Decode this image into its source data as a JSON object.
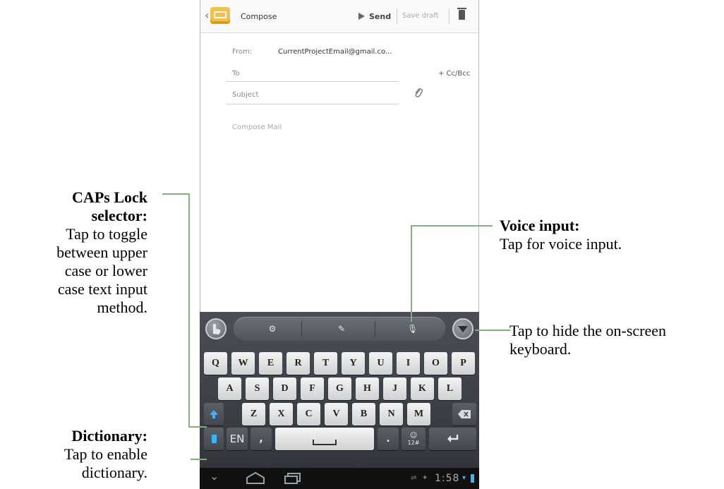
{
  "app": {
    "title": "Compose",
    "send_label": "Send",
    "save_draft_label": "Save draft",
    "from_label": "From:",
    "from_value": "CurrentProjectEmail@gmail.co...",
    "to_placeholder": "To",
    "ccbcc_label": "+ Cc/Bcc",
    "subject_placeholder": "Subject",
    "body_placeholder": "Compose Mail"
  },
  "keyboard": {
    "row1": [
      "Q",
      "W",
      "E",
      "R",
      "T",
      "Y",
      "U",
      "I",
      "O",
      "P"
    ],
    "row2": [
      "A",
      "S",
      "D",
      "F",
      "G",
      "H",
      "J",
      "K",
      "L"
    ],
    "row3": [
      "Z",
      "X",
      "C",
      "V",
      "B",
      "N",
      "M"
    ],
    "lang_label": "EN",
    "comma_label": ",",
    "period_label": ".",
    "symbols_label": "12#"
  },
  "statusbar": {
    "clock": "1:58"
  },
  "callouts": {
    "caps_title": "CAPs Lock selector:",
    "caps_lines": [
      "Tap to toggle",
      "between upper",
      "case or lower",
      "case text input",
      "method."
    ],
    "dict_title": "Dictionary:",
    "dict_lines": [
      "Tap to enable",
      "dictionary."
    ],
    "voice_title": "Voice input:",
    "voice_text": "Tap for voice input.",
    "hide_lines": [
      "Tap to hide the on-screen",
      "keyboard."
    ]
  },
  "colors": {
    "callout_line": "#7fb07d",
    "battery": "#3ab4ff"
  }
}
